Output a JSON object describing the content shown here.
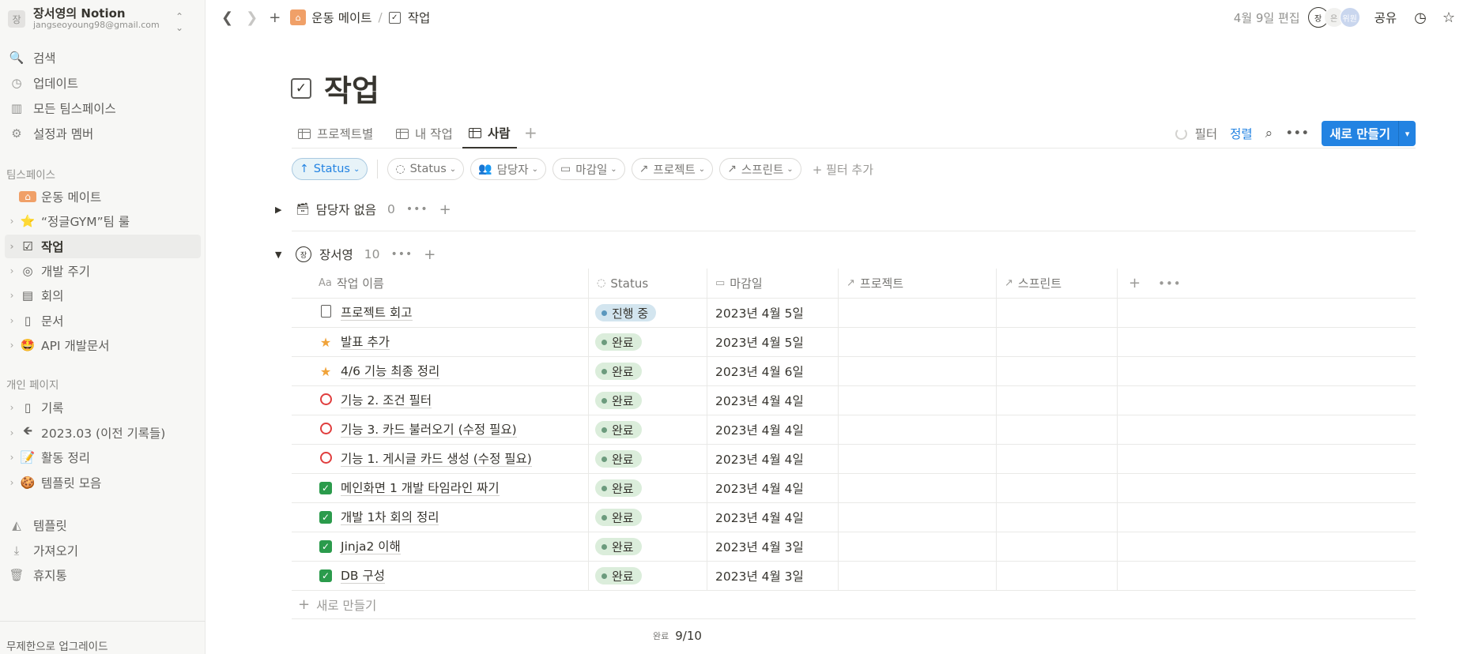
{
  "workspace": {
    "avatar": "장",
    "name": "장서영의 Notion",
    "email": "jangseoyoung98@gmail.com",
    "toggle_icon": "chevron-up-down-icon"
  },
  "sidebar": {
    "top_items": [
      {
        "label": "검색",
        "icon": "search-icon",
        "glyph": "🔍"
      },
      {
        "label": "업데이트",
        "icon": "clock-icon",
        "glyph": "◷"
      },
      {
        "label": "모든 팀스페이스",
        "icon": "building-icon",
        "glyph": "▥"
      },
      {
        "label": "설정과 멤버",
        "icon": "gear-icon",
        "glyph": "⚙"
      }
    ],
    "teamspace_header": "팀스페이스",
    "teamspace_items": [
      {
        "label": "운동 메이트",
        "glyph": "🏠",
        "icon": "house-icon",
        "chevron": false
      },
      {
        "label": "“정글GYM”팀 룰",
        "glyph": "⭐",
        "icon": "star-icon",
        "chevron": true
      },
      {
        "label": "작업",
        "glyph": "☑",
        "icon": "checkbox-icon",
        "chevron": true,
        "active": true
      },
      {
        "label": "개발 주기",
        "glyph": "◎",
        "icon": "target-icon",
        "chevron": true
      },
      {
        "label": "회의",
        "glyph": "▤",
        "icon": "meeting-icon",
        "chevron": true
      },
      {
        "label": "문서",
        "glyph": "▯",
        "icon": "document-icon",
        "chevron": true
      },
      {
        "label": "API 개발문서",
        "glyph": "🤩",
        "icon": "star-struck-icon",
        "chevron": true
      }
    ],
    "private_header": "개인 페이지",
    "private_items": [
      {
        "label": "기록",
        "glyph": "▯",
        "icon": "page-icon"
      },
      {
        "label": "2023.03 (이전 기록들)",
        "glyph": "🡸",
        "icon": "arrow-left-icon"
      },
      {
        "label": "활동 정리",
        "glyph": "📝",
        "icon": "memo-icon"
      },
      {
        "label": "템플릿 모음",
        "glyph": "🍪",
        "icon": "cookie-icon"
      }
    ],
    "bottom_items": [
      {
        "label": "템플릿",
        "glyph": "◭",
        "icon": "templates-icon"
      },
      {
        "label": "가져오기",
        "glyph": "⤓",
        "icon": "download-icon"
      },
      {
        "label": "휴지통",
        "glyph": "🗑",
        "icon": "trash-icon"
      }
    ],
    "upgrade": "무제한으로 업그레이드"
  },
  "topbar": {
    "breadcrumb_root": "운동 메이트",
    "breadcrumb_sep": "/",
    "breadcrumb_current": "작업",
    "edited": "4월 9일 편집",
    "avatars": [
      "장",
      "은",
      "위원"
    ],
    "share": "공유"
  },
  "page": {
    "title": "작업"
  },
  "views": {
    "tabs": [
      "프로젝트별",
      "내 작업",
      "사람"
    ],
    "active": "사람",
    "filter": "필터",
    "sort": "정렬",
    "new_button": "새로 만들기"
  },
  "filters": {
    "sort_chip": "Status",
    "chips": [
      {
        "label": "Status",
        "glyph": "◌"
      },
      {
        "label": "담당자",
        "glyph": "👥"
      },
      {
        "label": "마감일",
        "glyph": "▭"
      },
      {
        "label": "프로젝트",
        "glyph": "↗"
      },
      {
        "label": "스프린트",
        "glyph": "↗"
      }
    ],
    "add_filter": "필터 추가"
  },
  "groups": {
    "unassigned": {
      "label": "담당자 없음",
      "count": "0"
    },
    "person": {
      "avatar": "장",
      "label": "장서영",
      "count": "10"
    }
  },
  "table": {
    "columns": [
      "작업 이름",
      "Status",
      "마감일",
      "프로젝트",
      "스프린트"
    ],
    "column_glyphs": [
      "Aa",
      "◌",
      "▭",
      "↗",
      "↗"
    ],
    "rows": [
      {
        "icon": "doc",
        "name": "프로젝트 회고",
        "status": "진행 중",
        "status_kind": "prog",
        "date": "2023년 4월 5일"
      },
      {
        "icon": "star",
        "name": "발표 추가",
        "status": "완료",
        "status_kind": "done",
        "date": "2023년 4월 5일"
      },
      {
        "icon": "star",
        "name": "4/6 기능 최종 정리",
        "status": "완료",
        "status_kind": "done",
        "date": "2023년 4월 6일"
      },
      {
        "icon": "ring",
        "name": "기능 2. 조건 필터",
        "status": "완료",
        "status_kind": "done",
        "date": "2023년 4월 4일"
      },
      {
        "icon": "ring",
        "name": "기능 3. 카드 불러오기 (수정 필요)",
        "status": "완료",
        "status_kind": "done",
        "date": "2023년 4월 4일"
      },
      {
        "icon": "ring",
        "name": "기능 1. 게시글 카드 생성 (수정 필요)",
        "status": "완료",
        "status_kind": "done",
        "date": "2023년 4월 4일"
      },
      {
        "icon": "check",
        "name": "메인화면 1 개발 타임라인 짜기",
        "status": "완료",
        "status_kind": "done",
        "date": "2023년 4월 4일"
      },
      {
        "icon": "check",
        "name": "개발 1차 회의 정리",
        "status": "완료",
        "status_kind": "done",
        "date": "2023년 4월 4일"
      },
      {
        "icon": "check",
        "name": "Jinja2 이해",
        "status": "완료",
        "status_kind": "done",
        "date": "2023년 4월 3일"
      },
      {
        "icon": "check",
        "name": "DB 구성",
        "status": "완료",
        "status_kind": "done",
        "date": "2023년 4월 3일"
      }
    ],
    "new_row": "새로 만들기",
    "calc_label": "완료",
    "calc_value": "9/10"
  }
}
